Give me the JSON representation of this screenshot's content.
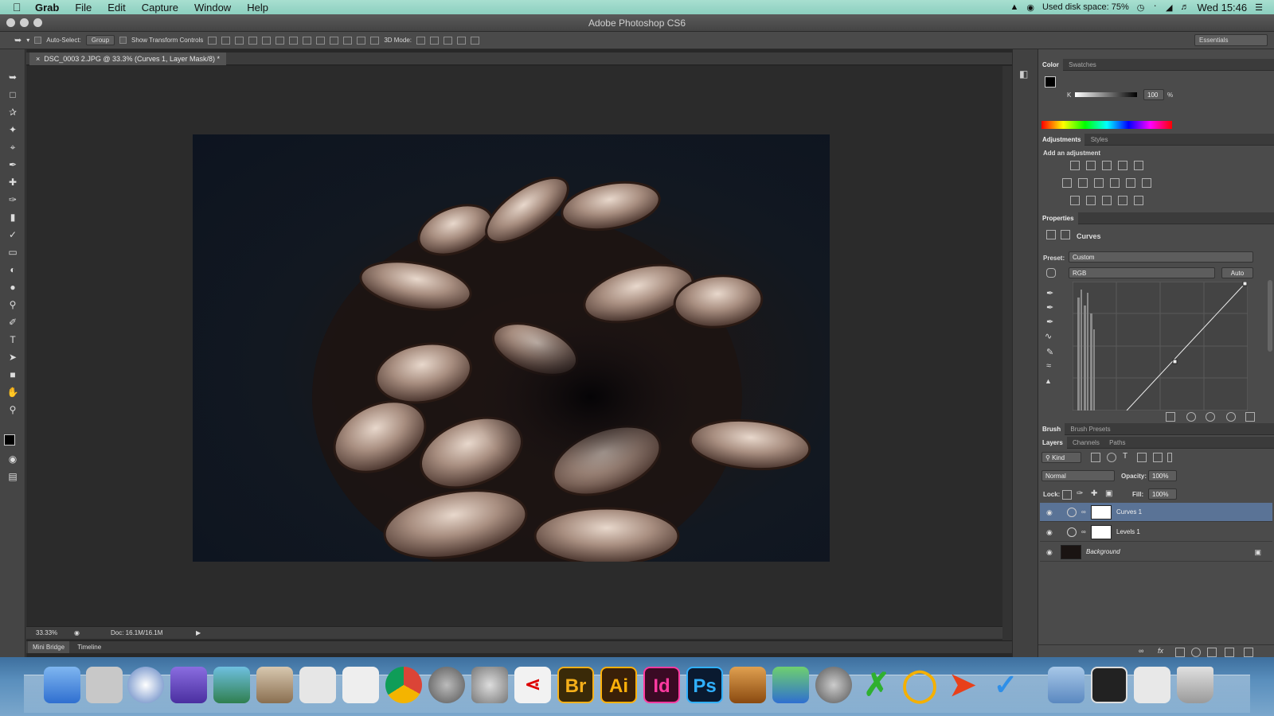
{
  "menubar": {
    "app": "Grab",
    "items": [
      "File",
      "Edit",
      "Capture",
      "Window",
      "Help"
    ],
    "disk": "Used disk space: 75%",
    "clock": "Wed 15:46"
  },
  "window": {
    "title": "Adobe Photoshop CS6"
  },
  "options": {
    "auto_select": "Auto-Select:",
    "group": "Group",
    "transform": "Show Transform Controls",
    "mode3d": "3D Mode:",
    "workspace": "Essentials"
  },
  "document": {
    "tab": "DSC_0003 2.JPG @ 33.3% (Curves 1, Layer Mask/8) *",
    "zoom": "33.33%",
    "doc_size": "Doc: 16.1M/16.1M"
  },
  "bottom_tabs": [
    "Mini Bridge",
    "Timeline"
  ],
  "color_panel": {
    "tabs": [
      "Color",
      "Swatches"
    ],
    "channel": "K",
    "value": "100",
    "unit": "%"
  },
  "adjustments_panel": {
    "tabs": [
      "Adjustments",
      "Styles"
    ],
    "hint": "Add an adjustment"
  },
  "properties": {
    "tab": "Properties",
    "title": "Curves",
    "preset_label": "Preset:",
    "preset": "Custom",
    "channel": "RGB",
    "auto": "Auto"
  },
  "brush_tabs": [
    "Brush",
    "Brush Presets"
  ],
  "layers_panel": {
    "tabs": [
      "Layers",
      "Channels",
      "Paths"
    ],
    "kind": "Kind",
    "blend": "Normal",
    "opacity_label": "Opacity:",
    "opacity": "100%",
    "lock_label": "Lock:",
    "fill_label": "Fill:",
    "fill": "100%",
    "layers": [
      "Curves 1",
      "Levels 1",
      "Background"
    ]
  },
  "dock_apps": {
    "bridge": "Br",
    "illustrator": "Ai",
    "indesign": "Id",
    "photoshop": "Ps"
  }
}
